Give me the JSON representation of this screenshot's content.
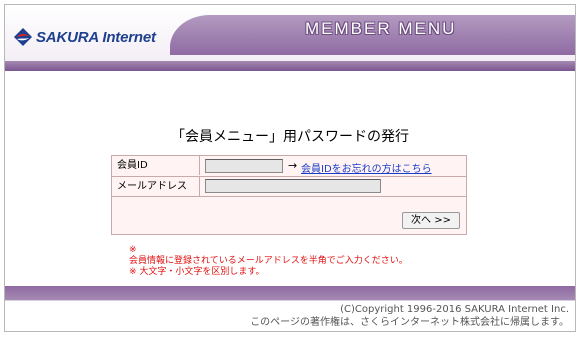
{
  "header": {
    "logo_text": "SAKURA Internet",
    "menu_title": "MEMBER MENU"
  },
  "page": {
    "title": "「会員メニュー」用パスワードの発行"
  },
  "form": {
    "member_id_label": "会員ID",
    "member_id_value": "",
    "forgot_link": "会員IDをお忘れの方はこちら",
    "arrow": "→",
    "email_label": "メールアドレス",
    "email_value": "",
    "next_button": "次へ >>"
  },
  "notes": {
    "mark": "※",
    "line1": "会員情報に登録されているメールアドレスを半角でご入力ください。",
    "line2": "※ 大文字・小文字を区別します。"
  },
  "footer": {
    "copyright": "(C)Copyright 1996-2016 SAKURA Internet Inc.",
    "rights": "このページの著作権は、さくらインターネット株式会社に帰属します。"
  },
  "colors": {
    "accent_purple": "#8f6aa3",
    "link_blue": "#1a3dc7",
    "note_red": "#e01010",
    "form_bg": "#fff3f3"
  }
}
